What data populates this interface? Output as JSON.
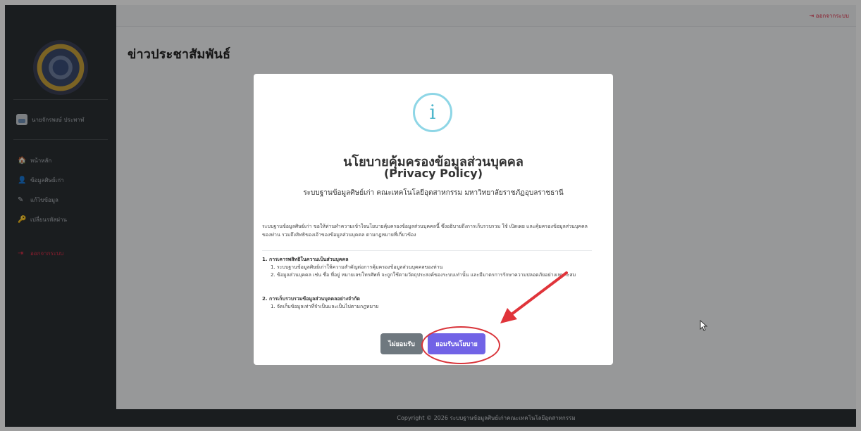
{
  "topbar": {
    "logout_label": "ออกจากระบบ",
    "logout_icon": "sign-out-icon",
    "accent_color": "#e0304a"
  },
  "sidebar": {
    "user_name": "นายจักรพงษ์ ประพาฬ",
    "items": [
      {
        "label": "หน้าหลัก",
        "icon": "home-icon",
        "glyph": "🏠"
      },
      {
        "label": "ข้อมูลศิษย์เก่า",
        "icon": "user-icon",
        "glyph": "👤"
      },
      {
        "label": "แก้ไขข้อมูล",
        "icon": "edit-icon",
        "glyph": "✎"
      },
      {
        "label": "เปลี่ยนรหัสผ่าน",
        "icon": "key-icon",
        "glyph": "🔑"
      }
    ],
    "logout": {
      "label": "ออกจากระบบ",
      "icon": "sign-out-icon",
      "glyph": "⇥"
    }
  },
  "page": {
    "title": "ข่าวประชาสัมพันธ์"
  },
  "modal": {
    "icon_glyph": "i",
    "title_line1": "นโยบายคุ้มครองข้อมูลส่วนบุคคล",
    "title_line2": "(Privacy Policy)",
    "subtitle": "ระบบฐานข้อมูลศิษย์เก่า คณะเทคโนโลยีอุตสาหกรรม มหาวิทยาลัยราชภัฏอุบลราชธานี",
    "intro": "ระบบฐานข้อมูลศิษย์เก่า ขอให้ท่านทำความเข้าใจนโยบายคุ้มครองข้อมูลส่วนบุคคลนี้ ซึ่งอธิบายถึงการเก็บรวบรวม ใช้ เปิดเผย และคุ้มครองข้อมูลส่วนบุคคลของท่าน รวมถึงสิทธิของเจ้าของข้อมูลส่วนบุคคล ตามกฎหมายที่เกี่ยวข้อง",
    "sections": [
      {
        "heading": "1. การเคารพสิทธิในความเป็นส่วนบุคคล",
        "items": [
          "1. ระบบฐานข้อมูลศิษย์เก่าให้ความสำคัญต่อการคุ้มครองข้อมูลส่วนบุคคลของท่าน",
          "2. ข้อมูลส่วนบุคคล เช่น ชื่อ ที่อยู่ หมายเลขโทรศัพท์ จะถูกใช้ตามวัตถุประสงค์ของระบบเท่านั้น และมีมาตรการรักษาความปลอดภัยอย่างเหมาะสม"
        ]
      },
      {
        "heading": "2. การเก็บรวบรวมข้อมูลส่วนบุคคลอย่างจำกัด",
        "items": [
          "1. จัดเก็บข้อมูลเท่าที่จำเป็นและเป็นไปตามกฎหมาย"
        ]
      }
    ],
    "decline_label": "ไม่ยอมรับ",
    "accept_label": "ยอมรับนโยบาย",
    "accept_color": "#7163e6",
    "decline_color": "#6f787f"
  },
  "footer": {
    "text": "Copyright © 2026 ระบบฐานข้อมูลศิษย์เก่าคณะเทคโนโลยีอุตสาหกรรม"
  }
}
